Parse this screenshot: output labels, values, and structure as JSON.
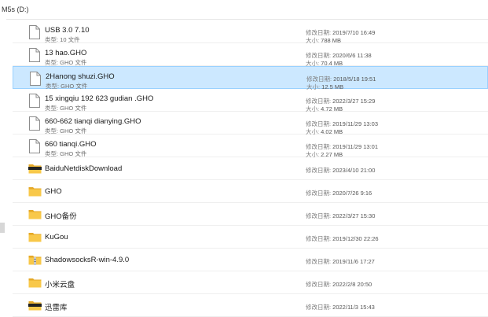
{
  "location": {
    "drive_label": "M5s (D:)"
  },
  "labels": {
    "type": "类型: ",
    "size": "大小: ",
    "modified": "修改日期: "
  },
  "items": [
    {
      "name": "USB 3.0 7.10",
      "kind": "file",
      "type": "10 文件",
      "size": "788 MB",
      "date": "2019/7/10 16:49",
      "selected": false
    },
    {
      "name": "13 hao.GHO",
      "kind": "file",
      "type": "GHO 文件",
      "size": "70.4 MB",
      "date": "2020/6/6 11:38",
      "selected": false
    },
    {
      "name": "2Hanong shuzi.GHO",
      "kind": "file",
      "type": "GHO 文件",
      "size": "12.5 MB",
      "date": "2018/5/18 19:51",
      "selected": true
    },
    {
      "name": "15 xingqiu 192 623 gudian .GHO",
      "kind": "file",
      "type": "GHO 文件",
      "size": "4.72 MB",
      "date": "2022/3/27 15:29",
      "selected": false
    },
    {
      "name": "660-662 tianqi dianying.GHO",
      "kind": "file",
      "type": "GHO 文件",
      "size": "4.02 MB",
      "date": "2019/11/29 13:03",
      "selected": false
    },
    {
      "name": "660 tianqi.GHO",
      "kind": "file",
      "type": "GHO 文件",
      "size": "2.27 MB",
      "date": "2019/11/29 13:01",
      "selected": false
    },
    {
      "name": "BaiduNetdiskDownload",
      "kind": "folder-special",
      "date": "2023/4/10 21:00",
      "selected": false
    },
    {
      "name": "GHO",
      "kind": "folder",
      "date": "2020/7/26 9:16",
      "selected": false
    },
    {
      "name": "GHO备份",
      "kind": "folder",
      "date": "2022/3/27 15:30",
      "selected": false
    },
    {
      "name": "KuGou",
      "kind": "folder",
      "date": "2019/12/30 22:26",
      "selected": false
    },
    {
      "name": "ShadowsocksR-win-4.9.0",
      "kind": "folder-zip",
      "date": "2019/11/6 17:27",
      "selected": false
    },
    {
      "name": "小米云盘",
      "kind": "folder",
      "date": "2022/2/8 20:50",
      "selected": false
    },
    {
      "name": "迅雷库",
      "kind": "folder-special",
      "date": "2022/11/3 15:43",
      "selected": false
    }
  ],
  "colors": {
    "selection_bg": "#cce8ff",
    "selection_border": "#99d1ff",
    "folder": "#f8c84a",
    "folder_dark": "#e5a826"
  }
}
